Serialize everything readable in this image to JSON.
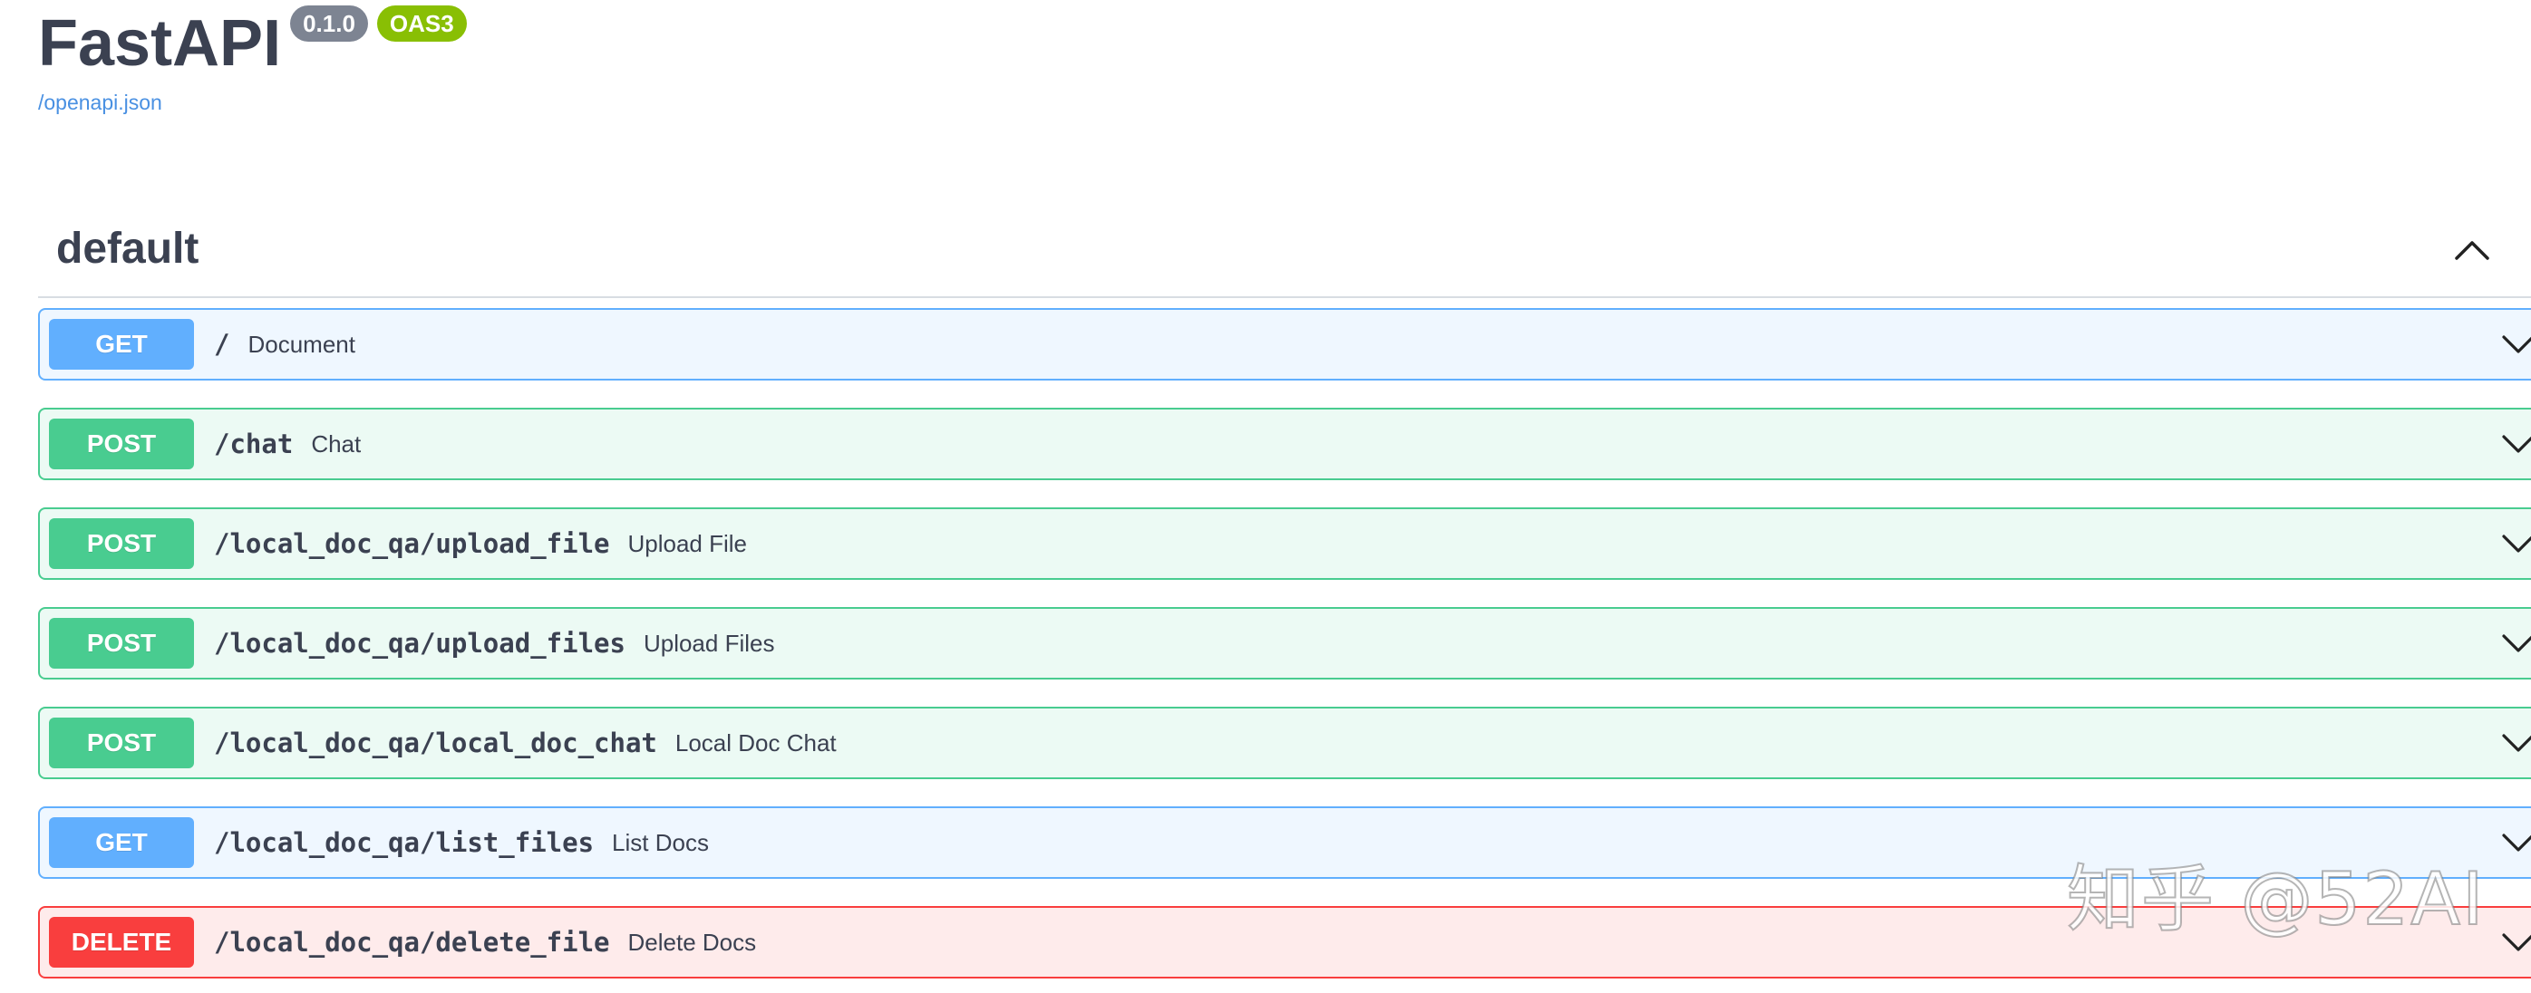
{
  "app": {
    "title": "FastAPI",
    "version_badge": "0.1.0",
    "oas_badge": "OAS3",
    "spec_link": "/openapi.json"
  },
  "section": {
    "title": "default",
    "toggle_icon": "chevron-up-icon"
  },
  "operations": [
    {
      "method": "GET",
      "path": "/",
      "summary": "Document"
    },
    {
      "method": "POST",
      "path": "/chat",
      "summary": "Chat"
    },
    {
      "method": "POST",
      "path": "/local_doc_qa/upload_file",
      "summary": "Upload File"
    },
    {
      "method": "POST",
      "path": "/local_doc_qa/upload_files",
      "summary": "Upload Files"
    },
    {
      "method": "POST",
      "path": "/local_doc_qa/local_doc_chat",
      "summary": "Local Doc Chat"
    },
    {
      "method": "GET",
      "path": "/local_doc_qa/list_files",
      "summary": "List Docs"
    },
    {
      "method": "DELETE",
      "path": "/local_doc_qa/delete_file",
      "summary": "Delete Docs"
    }
  ],
  "watermark": {
    "text": "知乎 @52AI"
  },
  "colors": {
    "get": "#61affe",
    "post": "#49cc90",
    "delete": "#f93e3e",
    "badge_version": "#7d8492",
    "badge_oas": "#89bf04",
    "link": "#4990e2"
  }
}
